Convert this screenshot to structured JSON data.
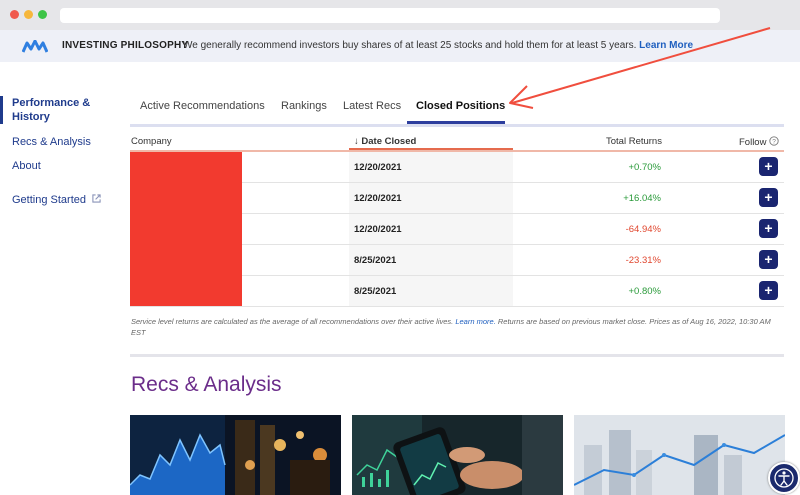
{
  "banner": {
    "title": "INVESTING PHILOSOPHY",
    "message": "We generally recommend investors buy shares of at least 25 stocks and hold them for at least 5 years.",
    "link": "Learn More"
  },
  "sidebar": {
    "items": [
      {
        "label": "Performance & History"
      },
      {
        "label": "Recs & Analysis"
      },
      {
        "label": "About"
      },
      {
        "label": "Getting Started"
      }
    ]
  },
  "tabs": [
    {
      "label": "Active Recommendations"
    },
    {
      "label": "Rankings"
    },
    {
      "label": "Latest Recs"
    },
    {
      "label": "Closed Positions"
    }
  ],
  "table": {
    "headers": {
      "company": "Company",
      "date": "Date Closed",
      "returns": "Total Returns",
      "follow": "Follow"
    },
    "rows": [
      {
        "date": "12/20/2021",
        "returns": "+0.70%"
      },
      {
        "date": "12/20/2021",
        "returns": "+16.04%"
      },
      {
        "date": "12/20/2021",
        "returns": "-64.94%"
      },
      {
        "date": "8/25/2021",
        "returns": "-23.31%"
      },
      {
        "date": "8/25/2021",
        "returns": "+0.80%"
      }
    ],
    "follow_label": "+"
  },
  "disclaimer": {
    "part1": "Service level returns are calculated as the average of all recommendations over their active lives.",
    "link": "Learn more.",
    "part2": "Returns are based on previous market close. Prices as of Aug 16, 2022, 10:30 AM EST"
  },
  "section": {
    "title": "Recs & Analysis"
  },
  "colors": {
    "accent": "#2d3e9e",
    "positive": "#2a9a3a",
    "negative": "#e0472f",
    "section_title": "#6b2d8a",
    "annotation": "#f04e3e"
  }
}
